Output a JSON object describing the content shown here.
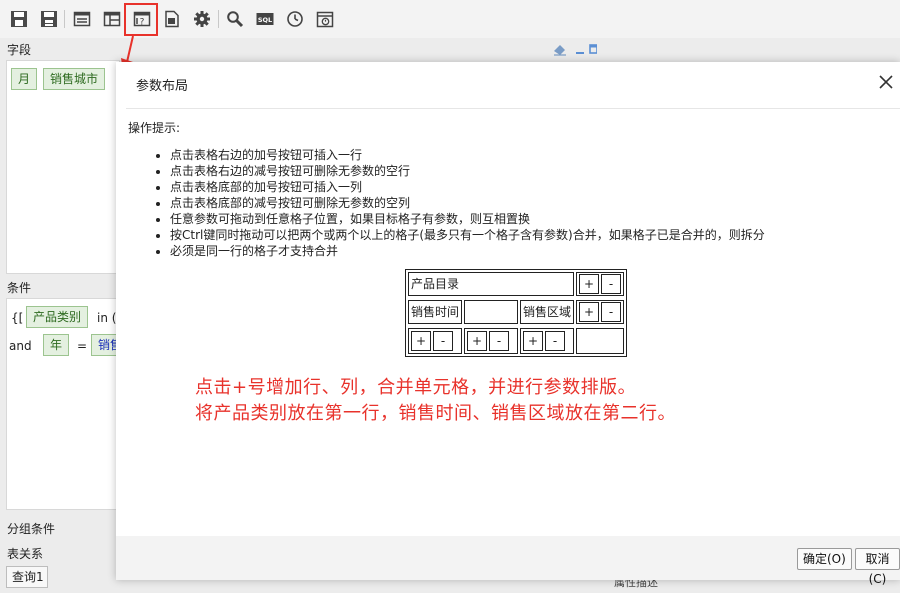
{
  "toolbar": {
    "buttons": [
      "save-icon",
      "save-as-icon",
      "layout-icon",
      "table-icon",
      "param-layout-icon",
      "export-icon",
      "gear-icon",
      "search-icon",
      "sql-icon",
      "clock-icon",
      "schedule-icon"
    ],
    "sql_label": "SQL"
  },
  "background": {
    "fields_label": "字段",
    "field_chips": [
      "月",
      "销售城市"
    ],
    "conditions_label": "条件",
    "cond_row1": {
      "open": "{[",
      "chip": "产品类别",
      "op": "in ("
    },
    "cond_row2": {
      "op": "and",
      "chip": "年",
      "eq": "=",
      "chip2": "销售"
    },
    "group_label": "分组条件",
    "relation_label": "表关系",
    "query_tab": "查询1",
    "partial_bottom": "属性描述"
  },
  "dialog": {
    "title": "参数布局",
    "hint_title": "操作提示:",
    "tips": [
      "点击表格右边的加号按钮可插入一行",
      "点击表格右边的减号按钮可删除无参数的空行",
      "点击表格底部的加号按钮可插入一列",
      "点击表格底部的减号按钮可删除无参数的空列",
      "任意参数可拖动到任意格子位置，如果目标格子有参数，则互相置换",
      "按Ctrl键同时拖动可以把两个或两个以上的格子(最多只有一个格子含有参数)合并，如果格子已是合并的，则拆分",
      "必须是同一行的格子才支持合并"
    ],
    "layout": {
      "row1_cell": "产品目录",
      "row2_cells": [
        "销售时间",
        "",
        "销售区域"
      ],
      "plus": "+",
      "minus": "-"
    },
    "annotation_line1": "点击+号增加行、列，合并单元格，并进行参数排版。",
    "annotation_line2": "将产品类别放在第一行，销售时间、销售区域放在第二行。",
    "ok_label": "确定(O)",
    "cancel_label": "取消(C)"
  },
  "colors": {
    "highlight": "#e8322b",
    "chip_bg": "#e4f0e0",
    "chip_text": "#2d6a1f"
  }
}
